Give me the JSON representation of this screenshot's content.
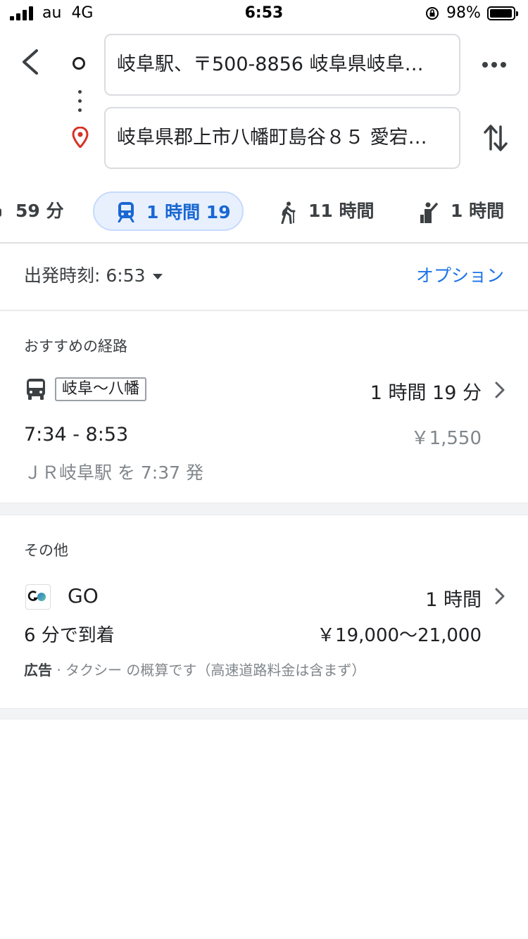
{
  "status_bar": {
    "carrier": "au",
    "network": "4G",
    "time": "6:53",
    "battery": "98%"
  },
  "search": {
    "origin": "岐阜駅、〒500-8856 岐阜県岐阜…",
    "destination": "岐阜県郡上市八幡町島谷８５ 愛宕…"
  },
  "modes": [
    {
      "label": "59 分",
      "icon": "car-icon"
    },
    {
      "label": "1 時間 19",
      "icon": "train-icon",
      "active": true
    },
    {
      "label": "11 時間",
      "icon": "walk-icon"
    },
    {
      "label": "1 時間",
      "icon": "ride-hail-icon"
    }
  ],
  "departure": {
    "label": "出発時刻: 6:53",
    "options": "オプション"
  },
  "recommended": {
    "title": "おすすめの経路",
    "line": "岐阜〜八幡",
    "duration": "1 時間 19 分",
    "times": "7:34 - 8:53",
    "fare": "￥1,550",
    "departs_from": "ＪＲ岐阜駅 を 7:37 発"
  },
  "others": {
    "title": "その他",
    "provider": "GO",
    "duration": "1 時間",
    "arrival": "6 分で到着",
    "fare": "￥19,000〜21,000",
    "ad_label": "広告",
    "ad_sep": " · ",
    "ad_text": "タクシー の概算です（高速道路料金は含まず）"
  },
  "colors": {
    "accent": "#1a73e8",
    "active_tab_bg": "#e8f0fe",
    "pin_red": "#d93025"
  }
}
